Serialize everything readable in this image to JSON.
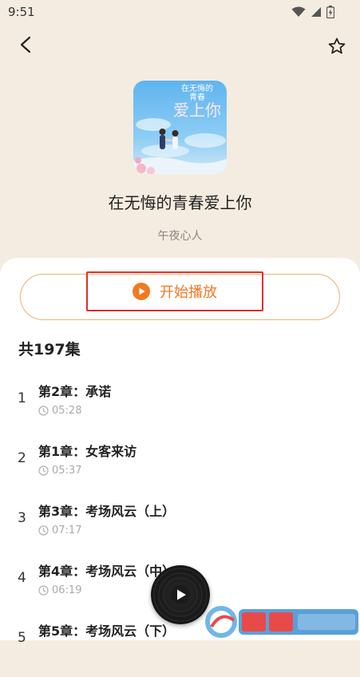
{
  "status_bar": {
    "time": "9:51",
    "icons": [
      "wifi-icon",
      "signal-icon",
      "battery-icon"
    ]
  },
  "nav": {
    "back_icon": "chevron-left-icon",
    "favorite_icon": "star-outline-icon"
  },
  "book": {
    "cover": {
      "line1": "在无悔的",
      "line2": "青春",
      "line3": "爱上你"
    },
    "title": "在无悔的青春爱上你",
    "author": "午夜心人"
  },
  "player_controls": {
    "play_all_label": "开始播放",
    "play_icon": "play-circle-icon"
  },
  "episodes": {
    "count_label": "共197集",
    "items": [
      {
        "index": "1",
        "title": "第2章：承诺",
        "duration": "05:28"
      },
      {
        "index": "2",
        "title": "第1章：女客来访",
        "duration": "05:37"
      },
      {
        "index": "3",
        "title": "第3章：考场风云（上）",
        "duration": "07:17"
      },
      {
        "index": "4",
        "title": "第4章：考场风云（中）",
        "duration": "06:19"
      },
      {
        "index": "5",
        "title": "第5章：考场风云（下）",
        "duration": ""
      }
    ]
  },
  "mini_player": {
    "icon": "play-icon"
  },
  "colors": {
    "header_bg": "#f4ece0",
    "accent": "#f07a20",
    "highlight_border": "#d8302a",
    "button_border": "#f0b070"
  }
}
